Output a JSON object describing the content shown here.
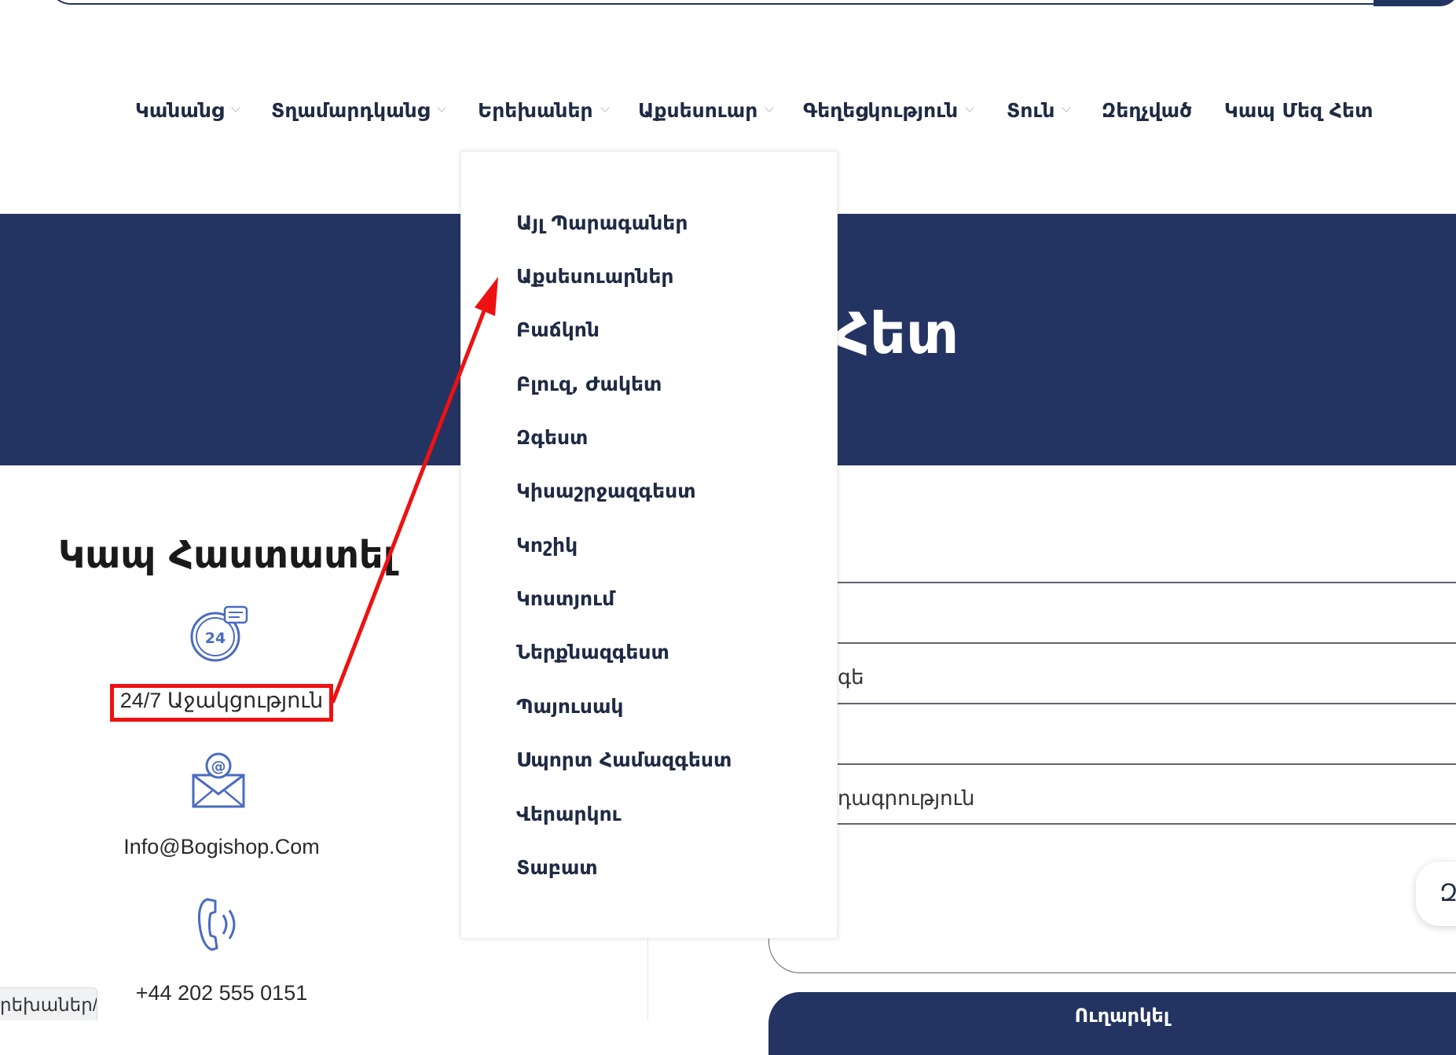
{
  "nav": {
    "items": [
      {
        "label": "Կանանց",
        "dropdown": true
      },
      {
        "label": "Տղամարդկանց",
        "dropdown": true
      },
      {
        "label": "Երեխաներ",
        "dropdown": true
      },
      {
        "label": "Աքսեսուար",
        "dropdown": true
      },
      {
        "label": "Գեղեցկություն",
        "dropdown": true
      },
      {
        "label": "Տուն",
        "dropdown": true
      },
      {
        "label": "Զեղչված",
        "dropdown": false
      },
      {
        "label": "Կապ Մեզ Հետ",
        "dropdown": false
      }
    ]
  },
  "dropdown": {
    "items": [
      "Այլ Պարագաներ",
      "Աքսեսուարներ",
      "Բաճկոն",
      "Բլուզ, Ժակետ",
      "Զգեստ",
      "Կիսաշրջազգեստ",
      "Կոշիկ",
      "Կոստյում",
      "Ներքնազգեստ",
      "Պայուսակ",
      "Սպորտ Համազգեստ",
      "Վերարկու",
      "Տաբատ"
    ]
  },
  "hero": {
    "title_visible": "Հետ"
  },
  "contact": {
    "heading": "Կապ Հաստատել",
    "support": "24/7 Աջակցություն",
    "email": "Info@Bogishop.Com",
    "phone": "+44 202 555 0151"
  },
  "form": {
    "field3_partial": "գե",
    "field5_partial": "դագրություն",
    "submit_partial": "Ուղարկել"
  },
  "chat": {
    "glyph_partial": "Զ"
  },
  "status": {
    "url_partial": "րեխաներ/"
  },
  "colors": {
    "primary": "#233462",
    "annotation": "#ee1111",
    "icon": "#4a6bbf"
  }
}
